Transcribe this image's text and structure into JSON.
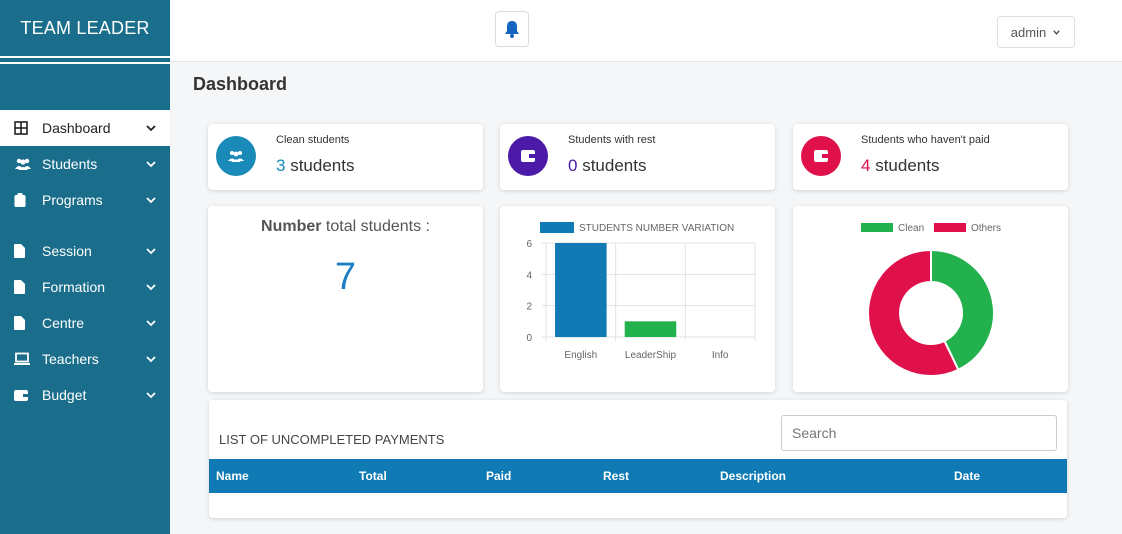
{
  "brand": "TEAM LEADER",
  "nav": [
    {
      "label": "Dashboard",
      "icon": "grid-icon"
    },
    {
      "label": "Students",
      "icon": "users-icon"
    },
    {
      "label": "Programs",
      "icon": "clipboard-icon"
    },
    {
      "label": "Session",
      "icon": "file-icon"
    },
    {
      "label": "Formation",
      "icon": "file-icon"
    },
    {
      "label": "Centre",
      "icon": "file-icon"
    },
    {
      "label": "Teachers",
      "icon": "laptop-icon"
    },
    {
      "label": "Budget",
      "icon": "wallet-icon"
    }
  ],
  "topbar": {
    "user": "admin"
  },
  "page_title": "Dashboard",
  "stats": [
    {
      "title": "Clean students",
      "count": "3",
      "suffix": " students",
      "color": "#1a8bb8",
      "icon": "users-icon"
    },
    {
      "title": "Students with rest",
      "count": "0",
      "suffix": " students",
      "color": "#4b1aa8",
      "icon": "wallet-icon"
    },
    {
      "title": "Students who haven't paid",
      "count": "4",
      "suffix": " students",
      "color": "#e0104a",
      "icon": "wallet-icon"
    }
  ],
  "total": {
    "label_bold": "Number",
    "label_rest": " total students :",
    "value": "7"
  },
  "colors": {
    "sidebar": "#1a6e8c",
    "bar": "#0f7ab4",
    "green": "#22b14c",
    "red": "#e0104a",
    "table_head": "#0f7ab4"
  },
  "chart_data": [
    {
      "type": "bar",
      "title": "",
      "categories": [
        "English",
        "LeaderShip",
        "Info"
      ],
      "series": [
        {
          "name": "STUDENTS NUMBER VARIATION",
          "values": [
            6,
            1,
            0
          ],
          "colors": [
            "#0f7ab4",
            "#22b14c",
            "#e0104a"
          ]
        }
      ],
      "ylim": [
        0,
        6
      ],
      "yticks": [
        "6",
        "4",
        "2",
        "0"
      ],
      "grid": true,
      "legend": "top"
    },
    {
      "type": "pie",
      "title": "",
      "labels": [
        "Clean",
        "Others"
      ],
      "values": [
        3,
        4
      ],
      "colors": [
        "#22b14c",
        "#e0104a"
      ],
      "legend": "top"
    }
  ],
  "table": {
    "title": "LIST OF UNCOMPLETED PAYMENTS",
    "search_placeholder": "Search",
    "columns": [
      "Name",
      "Total",
      "Paid",
      "Rest",
      "Description",
      "Date"
    ]
  }
}
